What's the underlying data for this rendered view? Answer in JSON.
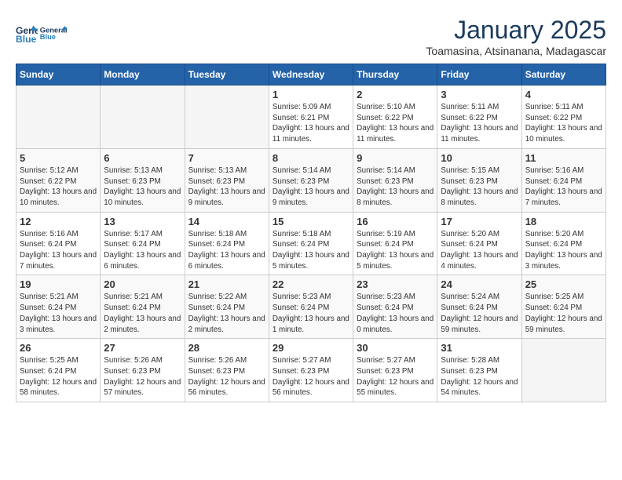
{
  "header": {
    "logo_line1": "General",
    "logo_line2": "Blue",
    "month_title": "January 2025",
    "location": "Toamasina, Atsinanana, Madagascar"
  },
  "days_of_week": [
    "Sunday",
    "Monday",
    "Tuesday",
    "Wednesday",
    "Thursday",
    "Friday",
    "Saturday"
  ],
  "weeks": [
    [
      {
        "num": "",
        "sunrise": "",
        "sunset": "",
        "daylight": "",
        "empty": true
      },
      {
        "num": "",
        "sunrise": "",
        "sunset": "",
        "daylight": "",
        "empty": true
      },
      {
        "num": "",
        "sunrise": "",
        "sunset": "",
        "daylight": "",
        "empty": true
      },
      {
        "num": "1",
        "sunrise": "Sunrise: 5:09 AM",
        "sunset": "Sunset: 6:21 PM",
        "daylight": "Daylight: 13 hours and 11 minutes."
      },
      {
        "num": "2",
        "sunrise": "Sunrise: 5:10 AM",
        "sunset": "Sunset: 6:22 PM",
        "daylight": "Daylight: 13 hours and 11 minutes."
      },
      {
        "num": "3",
        "sunrise": "Sunrise: 5:11 AM",
        "sunset": "Sunset: 6:22 PM",
        "daylight": "Daylight: 13 hours and 11 minutes."
      },
      {
        "num": "4",
        "sunrise": "Sunrise: 5:11 AM",
        "sunset": "Sunset: 6:22 PM",
        "daylight": "Daylight: 13 hours and 10 minutes."
      }
    ],
    [
      {
        "num": "5",
        "sunrise": "Sunrise: 5:12 AM",
        "sunset": "Sunset: 6:22 PM",
        "daylight": "Daylight: 13 hours and 10 minutes."
      },
      {
        "num": "6",
        "sunrise": "Sunrise: 5:13 AM",
        "sunset": "Sunset: 6:23 PM",
        "daylight": "Daylight: 13 hours and 10 minutes."
      },
      {
        "num": "7",
        "sunrise": "Sunrise: 5:13 AM",
        "sunset": "Sunset: 6:23 PM",
        "daylight": "Daylight: 13 hours and 9 minutes."
      },
      {
        "num": "8",
        "sunrise": "Sunrise: 5:14 AM",
        "sunset": "Sunset: 6:23 PM",
        "daylight": "Daylight: 13 hours and 9 minutes."
      },
      {
        "num": "9",
        "sunrise": "Sunrise: 5:14 AM",
        "sunset": "Sunset: 6:23 PM",
        "daylight": "Daylight: 13 hours and 8 minutes."
      },
      {
        "num": "10",
        "sunrise": "Sunrise: 5:15 AM",
        "sunset": "Sunset: 6:23 PM",
        "daylight": "Daylight: 13 hours and 8 minutes."
      },
      {
        "num": "11",
        "sunrise": "Sunrise: 5:16 AM",
        "sunset": "Sunset: 6:24 PM",
        "daylight": "Daylight: 13 hours and 7 minutes."
      }
    ],
    [
      {
        "num": "12",
        "sunrise": "Sunrise: 5:16 AM",
        "sunset": "Sunset: 6:24 PM",
        "daylight": "Daylight: 13 hours and 7 minutes."
      },
      {
        "num": "13",
        "sunrise": "Sunrise: 5:17 AM",
        "sunset": "Sunset: 6:24 PM",
        "daylight": "Daylight: 13 hours and 6 minutes."
      },
      {
        "num": "14",
        "sunrise": "Sunrise: 5:18 AM",
        "sunset": "Sunset: 6:24 PM",
        "daylight": "Daylight: 13 hours and 6 minutes."
      },
      {
        "num": "15",
        "sunrise": "Sunrise: 5:18 AM",
        "sunset": "Sunset: 6:24 PM",
        "daylight": "Daylight: 13 hours and 5 minutes."
      },
      {
        "num": "16",
        "sunrise": "Sunrise: 5:19 AM",
        "sunset": "Sunset: 6:24 PM",
        "daylight": "Daylight: 13 hours and 5 minutes."
      },
      {
        "num": "17",
        "sunrise": "Sunrise: 5:20 AM",
        "sunset": "Sunset: 6:24 PM",
        "daylight": "Daylight: 13 hours and 4 minutes."
      },
      {
        "num": "18",
        "sunrise": "Sunrise: 5:20 AM",
        "sunset": "Sunset: 6:24 PM",
        "daylight": "Daylight: 13 hours and 3 minutes."
      }
    ],
    [
      {
        "num": "19",
        "sunrise": "Sunrise: 5:21 AM",
        "sunset": "Sunset: 6:24 PM",
        "daylight": "Daylight: 13 hours and 3 minutes."
      },
      {
        "num": "20",
        "sunrise": "Sunrise: 5:21 AM",
        "sunset": "Sunset: 6:24 PM",
        "daylight": "Daylight: 13 hours and 2 minutes."
      },
      {
        "num": "21",
        "sunrise": "Sunrise: 5:22 AM",
        "sunset": "Sunset: 6:24 PM",
        "daylight": "Daylight: 13 hours and 2 minutes."
      },
      {
        "num": "22",
        "sunrise": "Sunrise: 5:23 AM",
        "sunset": "Sunset: 6:24 PM",
        "daylight": "Daylight: 13 hours and 1 minute."
      },
      {
        "num": "23",
        "sunrise": "Sunrise: 5:23 AM",
        "sunset": "Sunset: 6:24 PM",
        "daylight": "Daylight: 13 hours and 0 minutes."
      },
      {
        "num": "24",
        "sunrise": "Sunrise: 5:24 AM",
        "sunset": "Sunset: 6:24 PM",
        "daylight": "Daylight: 12 hours and 59 minutes."
      },
      {
        "num": "25",
        "sunrise": "Sunrise: 5:25 AM",
        "sunset": "Sunset: 6:24 PM",
        "daylight": "Daylight: 12 hours and 59 minutes."
      }
    ],
    [
      {
        "num": "26",
        "sunrise": "Sunrise: 5:25 AM",
        "sunset": "Sunset: 6:24 PM",
        "daylight": "Daylight: 12 hours and 58 minutes."
      },
      {
        "num": "27",
        "sunrise": "Sunrise: 5:26 AM",
        "sunset": "Sunset: 6:23 PM",
        "daylight": "Daylight: 12 hours and 57 minutes."
      },
      {
        "num": "28",
        "sunrise": "Sunrise: 5:26 AM",
        "sunset": "Sunset: 6:23 PM",
        "daylight": "Daylight: 12 hours and 56 minutes."
      },
      {
        "num": "29",
        "sunrise": "Sunrise: 5:27 AM",
        "sunset": "Sunset: 6:23 PM",
        "daylight": "Daylight: 12 hours and 56 minutes."
      },
      {
        "num": "30",
        "sunrise": "Sunrise: 5:27 AM",
        "sunset": "Sunset: 6:23 PM",
        "daylight": "Daylight: 12 hours and 55 minutes."
      },
      {
        "num": "31",
        "sunrise": "Sunrise: 5:28 AM",
        "sunset": "Sunset: 6:23 PM",
        "daylight": "Daylight: 12 hours and 54 minutes."
      },
      {
        "num": "",
        "sunrise": "",
        "sunset": "",
        "daylight": "",
        "empty": true
      }
    ]
  ]
}
